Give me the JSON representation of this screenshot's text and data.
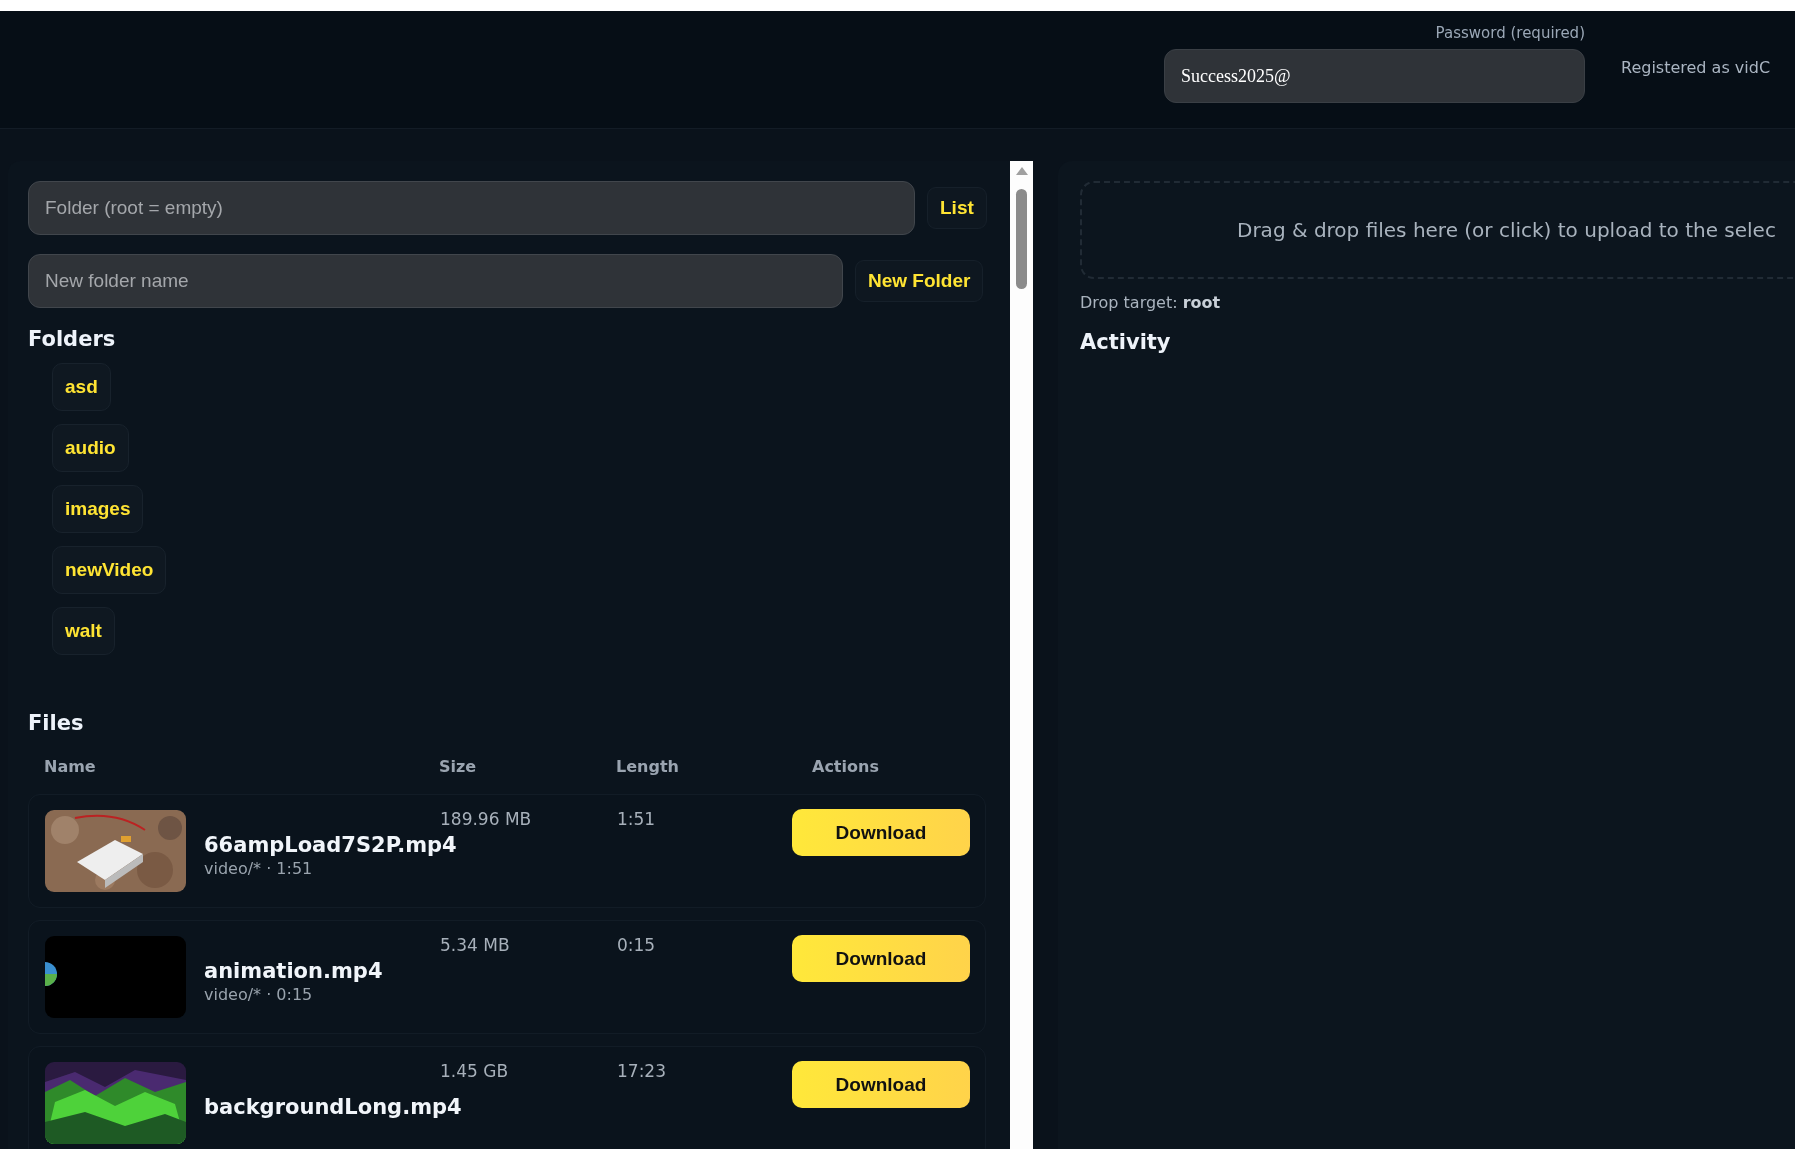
{
  "header": {
    "password": {
      "label": "Password (required)",
      "value": "Success2025@"
    },
    "status": "Registered as vidC"
  },
  "browser": {
    "folder_field": {
      "placeholder": "Folder (root = empty)"
    },
    "list_button": "List",
    "new_folder_field": {
      "placeholder": "New folder name"
    },
    "new_folder_button": "New Folder",
    "folders_title": "Folders",
    "folders": [
      "asd",
      "audio",
      "images",
      "newVideo",
      "walt"
    ],
    "files_title": "Files",
    "columns": [
      "Name",
      "Size",
      "Length",
      "Actions"
    ],
    "files": [
      {
        "name": "66ampLoad7S2P.mp4",
        "meta": "video/* · 1:51",
        "size": "189.96 MB",
        "length": "1:51",
        "action": "Download"
      },
      {
        "name": "animation.mp4",
        "meta": "video/* · 0:15",
        "size": "5.34 MB",
        "length": "0:15",
        "action": "Download"
      },
      {
        "name": "backgroundLong.mp4",
        "size": "1.45 GB",
        "length": "17:23",
        "action": "Download"
      }
    ]
  },
  "upload": {
    "drop_text": "Drag & drop files here (or click) to upload to the selec",
    "drop_target": "Drop target: **root**",
    "activity_title": "Activity"
  }
}
